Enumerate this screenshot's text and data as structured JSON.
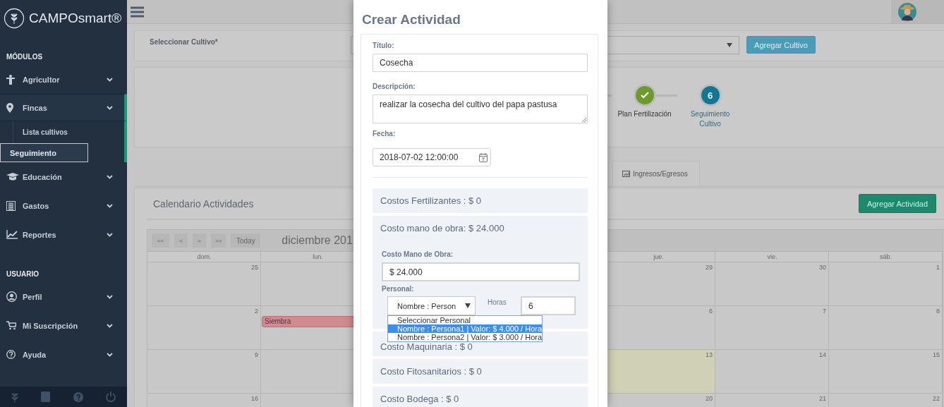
{
  "sidebar": {
    "brand": "CAMPOsmart®",
    "sections": [
      {
        "title": "MÓDULOS",
        "items": [
          {
            "label": "Agricultor",
            "selected": false
          },
          {
            "label": "Fincas",
            "selected": true,
            "children": [
              {
                "label": "Lista cultivos",
                "selected": false
              },
              {
                "label": "Seguimiento",
                "selected": true
              }
            ]
          },
          {
            "label": "Educación",
            "selected": false
          },
          {
            "label": "Gastos",
            "selected": false
          },
          {
            "label": "Reportes",
            "selected": false
          }
        ]
      },
      {
        "title": "USUARIO",
        "items": [
          {
            "label": "Perfil",
            "selected": false
          },
          {
            "label": "Mi Suscripción",
            "selected": false
          },
          {
            "label": "Ayuda",
            "selected": false
          }
        ]
      }
    ]
  },
  "crop_selector": {
    "label": "Seleccionar Cultivo*",
    "button": "Agregar Cultivo"
  },
  "steps": [
    {
      "label": "Plan Fertilización",
      "kind": "done"
    },
    {
      "label": "Seguimiento Cultivo",
      "kind": "current",
      "number": "6"
    }
  ],
  "tabs": [
    {
      "label": "Ingresos/Egresos",
      "selected": false
    }
  ],
  "calendar": {
    "title": "Calendario Actividades",
    "add_button": "Agregar Actividad",
    "nav_buttons": [
      "<<",
      "<",
      ">",
      ">>",
      "Today"
    ],
    "month": "diciembre 201",
    "day_headers": [
      "dom.",
      "lun.",
      "jue.",
      "vie.",
      "sáb."
    ],
    "weeks": [
      {
        "days": [
          {
            "date": "25",
            "today": false
          },
          {
            "date": "29",
            "today": false
          },
          {
            "date": "30",
            "today": false
          },
          {
            "date": "1",
            "today": false
          }
        ]
      },
      {
        "days": [
          {
            "date": "2",
            "today": false
          },
          {
            "date": "6",
            "today": false
          },
          {
            "date": "7",
            "today": false
          },
          {
            "date": "8",
            "today": false
          }
        ],
        "events": [
          {
            "title": "Siembra",
            "color": "#d08b90"
          }
        ]
      },
      {
        "days": [
          {
            "date": "9",
            "today": false
          },
          {
            "date": "13",
            "today": true
          },
          {
            "date": "14",
            "today": false
          },
          {
            "date": "15",
            "today": false
          }
        ]
      },
      {
        "days": [
          {
            "date": "16",
            "today": false
          },
          {
            "date": "20",
            "today": false
          },
          {
            "date": "21",
            "today": false
          },
          {
            "date": "22",
            "today": false
          }
        ]
      }
    ]
  },
  "modal": {
    "title": "Crear Actividad",
    "fields": [
      {
        "label": "Título:",
        "kind": "text",
        "value": "Cosecha"
      },
      {
        "label": "Descripción:",
        "kind": "textarea",
        "value": "realizar la cosecha del cultivo del papa pastusa"
      },
      {
        "label": "Fecha:",
        "kind": "date",
        "value": "2018-07-02 12:00:00"
      }
    ],
    "cost_sections": [
      {
        "title": "Costos Fertilizantes : $ 0"
      },
      {
        "title": "Costo mano de obra: $ 24.000",
        "form": {
          "cost_label": "Costo Mano de Obra:",
          "cost_value": "$ 24.000",
          "personal_label": "Personal:",
          "personal_select": {
            "value": "Nombre : Person",
            "options": [
              {
                "label": "Seleccionar Personal",
                "selected": false
              },
              {
                "label": "Nombre : Persona1 | Valor: $ 4.000 / Hora",
                "selected": true
              },
              {
                "label": "Nombre : Persona2 | Valor: $ 3.000 / Hora",
                "selected": false
              }
            ]
          },
          "hours_label": "Horas",
          "hours_value": "6"
        }
      },
      {
        "title": "Costo Maquinaria : $ 0"
      },
      {
        "title": "Costo Fitosanitarios : $ 0"
      },
      {
        "title": "Costo Bodega : $ 0"
      }
    ]
  }
}
